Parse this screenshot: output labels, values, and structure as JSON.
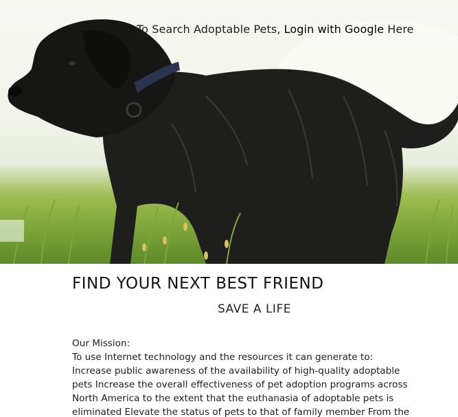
{
  "hero": {
    "login_prefix": "To Search Adoptable Pets, ",
    "login_link": "Login with Google",
    "login_suffix": " Here"
  },
  "main": {
    "headline": "FIND YOUR NEXT BEST FRIEND",
    "subhead": "SAVE A LIFE",
    "mission_title": "Our Mission:",
    "mission_intro": "To use Internet technology and the resources it can generate to:",
    "mission_body": "Increase public awareness of the availability of high-quality adoptable pets Increase the overall effectiveness of pet adoption programs across North America to the extent that the euthanasia of adoptable pets is eliminated Elevate the status of pets to that of family member From the"
  }
}
